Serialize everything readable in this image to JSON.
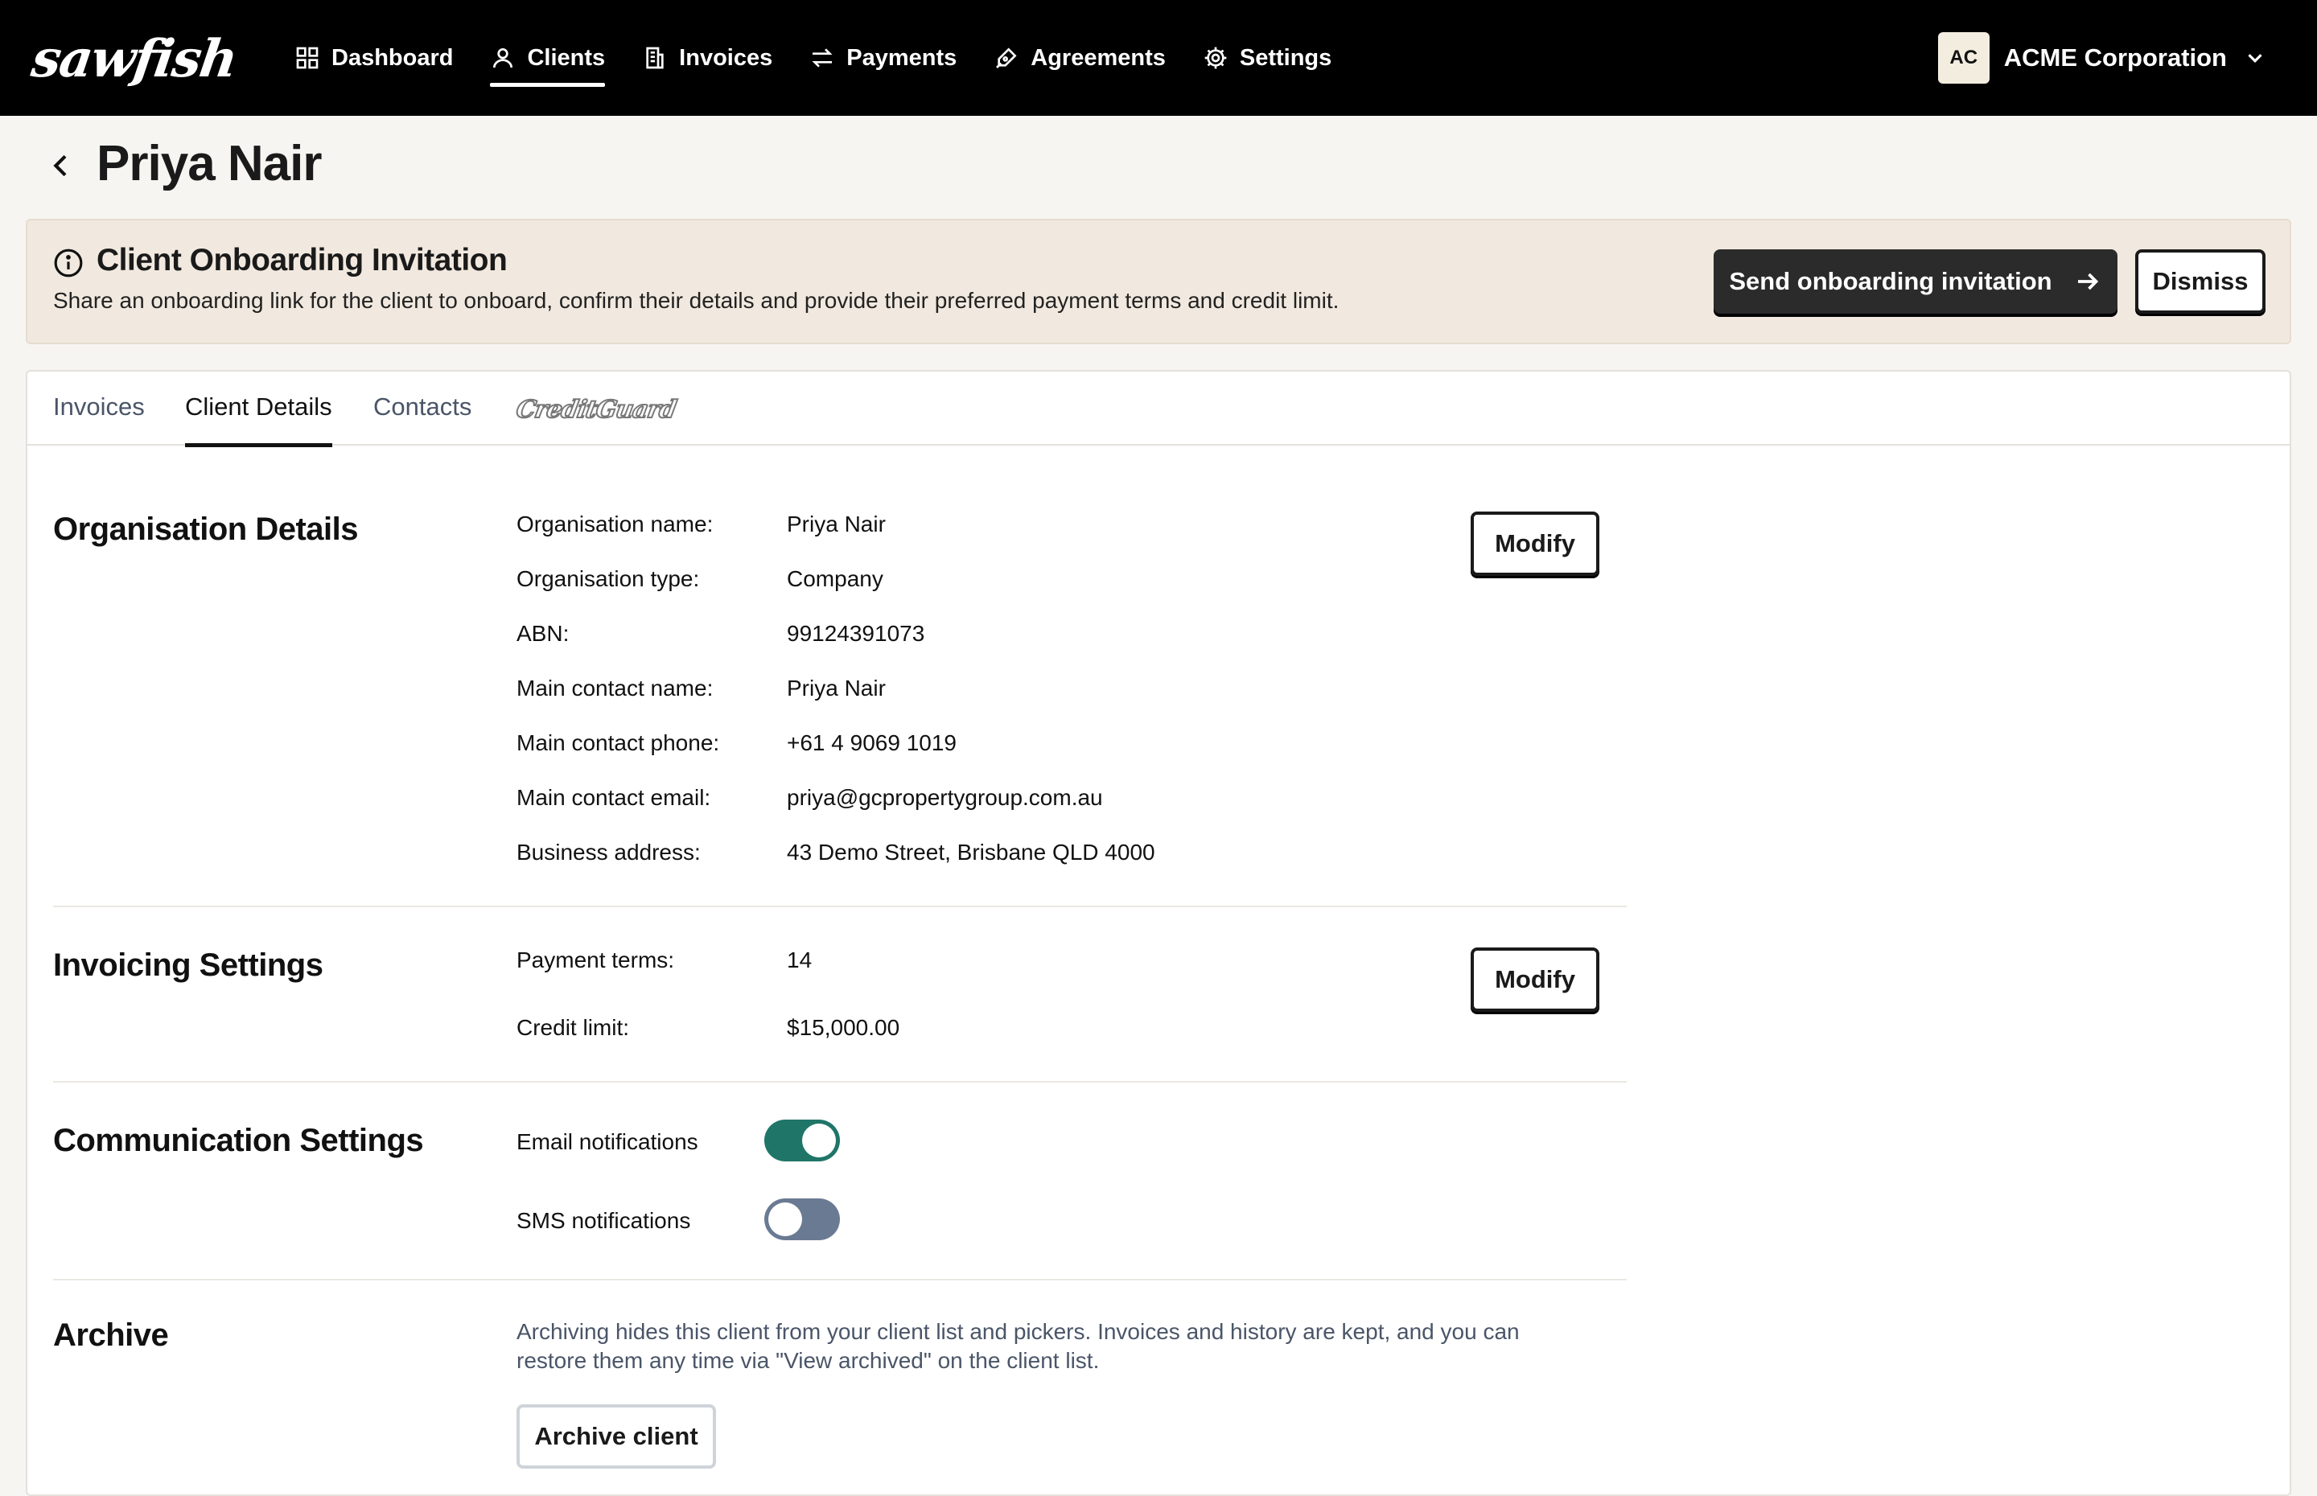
{
  "nav": {
    "logo": "sawfish",
    "items": [
      {
        "label": "Dashboard",
        "icon": "dashboard-icon"
      },
      {
        "label": "Clients",
        "icon": "user-icon"
      },
      {
        "label": "Invoices",
        "icon": "invoice-icon"
      },
      {
        "label": "Payments",
        "icon": "transfer-icon"
      },
      {
        "label": "Agreements",
        "icon": "pen-icon"
      },
      {
        "label": "Settings",
        "icon": "gear-icon"
      }
    ],
    "active": "Clients",
    "org": {
      "initials": "AC",
      "name": "ACME Corporation"
    }
  },
  "page": {
    "title": "Priya Nair"
  },
  "banner": {
    "title": "Client Onboarding Invitation",
    "text": "Share an onboarding link for the client to onboard, confirm their details and provide their preferred payment terms and credit limit.",
    "primary_label": "Send onboarding invitation",
    "dismiss_label": "Dismiss",
    "background": "#f1e9df"
  },
  "tabs": {
    "items": [
      "Invoices",
      "Client Details",
      "Contacts"
    ],
    "active": "Client Details",
    "creditguard": "CreditGuard"
  },
  "organisation": {
    "title": "Organisation Details",
    "modify_label": "Modify",
    "fields": [
      {
        "label": "Organisation name:",
        "value": "Priya Nair"
      },
      {
        "label": "Organisation type:",
        "value": "Company"
      },
      {
        "label": "ABN:",
        "value": "99124391073"
      },
      {
        "label": "Main contact name:",
        "value": "Priya Nair"
      },
      {
        "label": "Main contact phone:",
        "value": "+61 4 9069 1019"
      },
      {
        "label": "Main contact email:",
        "value": "priya@gcpropertygroup.com.au"
      },
      {
        "label": "Business address:",
        "value": "43 Demo Street, Brisbane QLD 4000"
      }
    ]
  },
  "invoicing": {
    "title": "Invoicing Settings",
    "modify_label": "Modify",
    "fields": [
      {
        "label": "Payment terms:",
        "value": "14"
      },
      {
        "label": "Credit limit:",
        "value": "$15,000.00"
      }
    ]
  },
  "communication": {
    "title": "Communication Settings",
    "email_label": "Email notifications",
    "email_enabled": true,
    "sms_label": "SMS notifications",
    "sms_enabled": false,
    "on_color": "#1f7568",
    "off_color": "#6b7a93"
  },
  "archive": {
    "title": "Archive",
    "text": "Archiving hides this client from your client list and pickers. Invoices and history are kept, and you can restore them any time via \"View archived\" on the client list.",
    "button_label": "Archive client"
  }
}
